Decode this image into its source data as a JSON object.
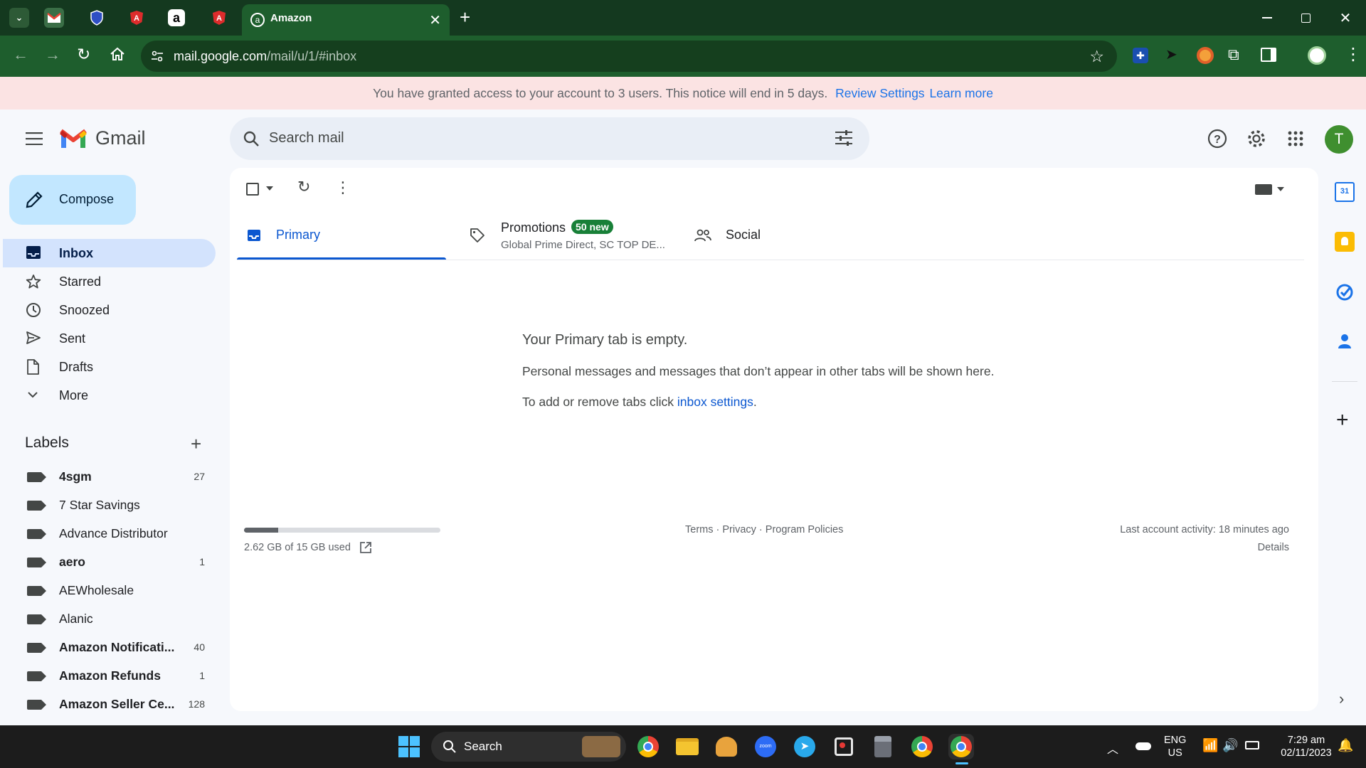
{
  "browser": {
    "active_tab_title": "Amazon",
    "url_host": "mail.google.com",
    "url_path": "/mail/u/1/#inbox"
  },
  "notice": {
    "text": "You have granted access to your account to 3 users. This notice will end in 5 days.",
    "review_link": "Review Settings",
    "learn_link": "Learn more"
  },
  "gmail": {
    "logo_text": "Gmail",
    "search_placeholder": "Search mail",
    "avatar_letter": "T",
    "compose_label": "Compose"
  },
  "nav": [
    {
      "label": "Inbox",
      "icon": "inbox-icon",
      "active": true
    },
    {
      "label": "Starred",
      "icon": "star-icon"
    },
    {
      "label": "Snoozed",
      "icon": "clock-icon"
    },
    {
      "label": "Sent",
      "icon": "send-icon"
    },
    {
      "label": "Drafts",
      "icon": "draft-icon"
    },
    {
      "label": "More",
      "icon": "chevron-down-icon"
    }
  ],
  "labels_title": "Labels",
  "labels": [
    {
      "name": "4sgm",
      "count": "27",
      "bold": true
    },
    {
      "name": "7 Star Savings",
      "count": "",
      "bold": false
    },
    {
      "name": "Advance Distributor",
      "count": "",
      "bold": false
    },
    {
      "name": "aero",
      "count": "1",
      "bold": true
    },
    {
      "name": "AEWholesale",
      "count": "",
      "bold": false
    },
    {
      "name": "Alanic",
      "count": "",
      "bold": false
    },
    {
      "name": "Amazon Notificati...",
      "count": "40",
      "bold": true
    },
    {
      "name": "Amazon Refunds",
      "count": "1",
      "bold": true
    },
    {
      "name": "Amazon Seller Ce...",
      "count": "128",
      "bold": true
    }
  ],
  "tabs": {
    "primary": "Primary",
    "promotions": "Promotions",
    "promotions_badge": "50 new",
    "promotions_snippet": "Global Prime Direct, SC TOP DE...",
    "social": "Social"
  },
  "empty_state": {
    "title": "Your Primary tab is empty.",
    "body": "Personal messages and messages that don’t appear in other tabs will be shown here.",
    "settings_prefix": "To add or remove tabs click ",
    "settings_link": "inbox settings",
    "settings_suffix": "."
  },
  "footer": {
    "storage_text": "2.62 GB of 15 GB used",
    "storage_fraction": 0.175,
    "links": "Terms · Privacy · Program Policies",
    "last_activity": "Last account activity: 18 minutes ago",
    "details": "Details"
  },
  "taskbar": {
    "search_label": "Search",
    "lang_line1": "ENG",
    "lang_line2": "US",
    "time": "7:29 am",
    "date": "02/11/2023"
  },
  "colors": {
    "chrome_frame": "#14391f",
    "chrome_toolbar": "#1e5e2d",
    "notice_bg": "#fbe3e3",
    "gmail_blue": "#0b57d0",
    "promo_badge": "#188038"
  }
}
